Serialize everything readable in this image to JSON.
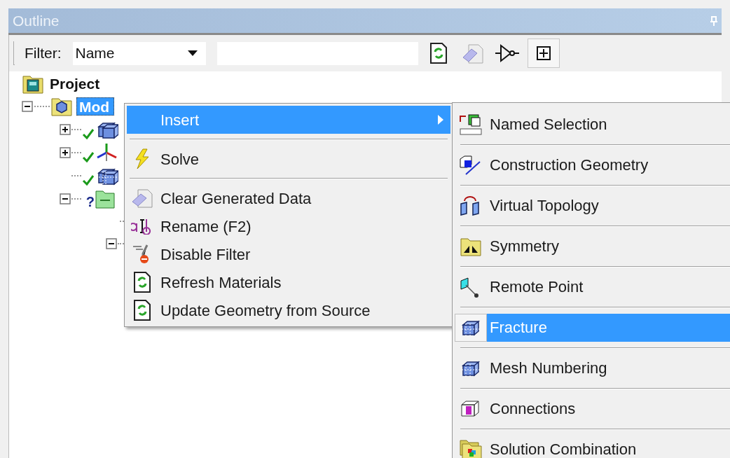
{
  "panel": {
    "title": "Outline"
  },
  "toolbar": {
    "filter_label": "Filter:",
    "filter_value": "Name",
    "expand_toggle": {
      "pressed": true
    }
  },
  "tree": [
    {
      "label": "Project",
      "kind": "project",
      "children": [
        {
          "label": "Mod",
          "kind": "model",
          "selected": true,
          "expanded": true,
          "children": [
            {
              "kind": "geometry",
              "expanded": false,
              "solved": true
            },
            {
              "kind": "coordinates",
              "expanded": false,
              "solved": true
            },
            {
              "kind": "mesh",
              "solved": true
            },
            {
              "kind": "folder",
              "expanded": true,
              "solved": false,
              "status_mark": "?",
              "children": [
                {
                  "kind": "leaf"
                },
                {
                  "kind": "branch",
                  "expanded": true
                }
              ]
            }
          ]
        }
      ]
    }
  ],
  "context_menu": {
    "items": [
      {
        "kind": "item",
        "label": "Insert",
        "selected": true,
        "submenu": true
      },
      {
        "kind": "separator"
      },
      {
        "kind": "item",
        "label": "Solve",
        "selected": false,
        "submenu": false
      },
      {
        "kind": "separator"
      },
      {
        "kind": "item",
        "label": "Clear Generated Data",
        "selected": false,
        "submenu": false
      },
      {
        "kind": "item",
        "label": "Rename (F2)",
        "selected": false,
        "submenu": false
      },
      {
        "kind": "item",
        "label": "Disable Filter",
        "selected": false,
        "submenu": false
      },
      {
        "kind": "item",
        "label": "Refresh Materials",
        "selected": false,
        "submenu": false
      },
      {
        "kind": "item",
        "label": "Update Geometry from Source",
        "selected": false,
        "submenu": false
      }
    ]
  },
  "submenu": {
    "items": [
      {
        "label": "Named Selection",
        "selected": false
      },
      {
        "label": "Construction Geometry",
        "selected": false
      },
      {
        "label": "Virtual Topology",
        "selected": false
      },
      {
        "label": "Symmetry",
        "selected": false
      },
      {
        "label": "Remote Point",
        "selected": false
      },
      {
        "label": "Fracture",
        "selected": true
      },
      {
        "label": "Mesh Numbering",
        "selected": false
      },
      {
        "label": "Connections",
        "selected": false
      },
      {
        "label": "Solution Combination",
        "selected": false
      }
    ]
  }
}
